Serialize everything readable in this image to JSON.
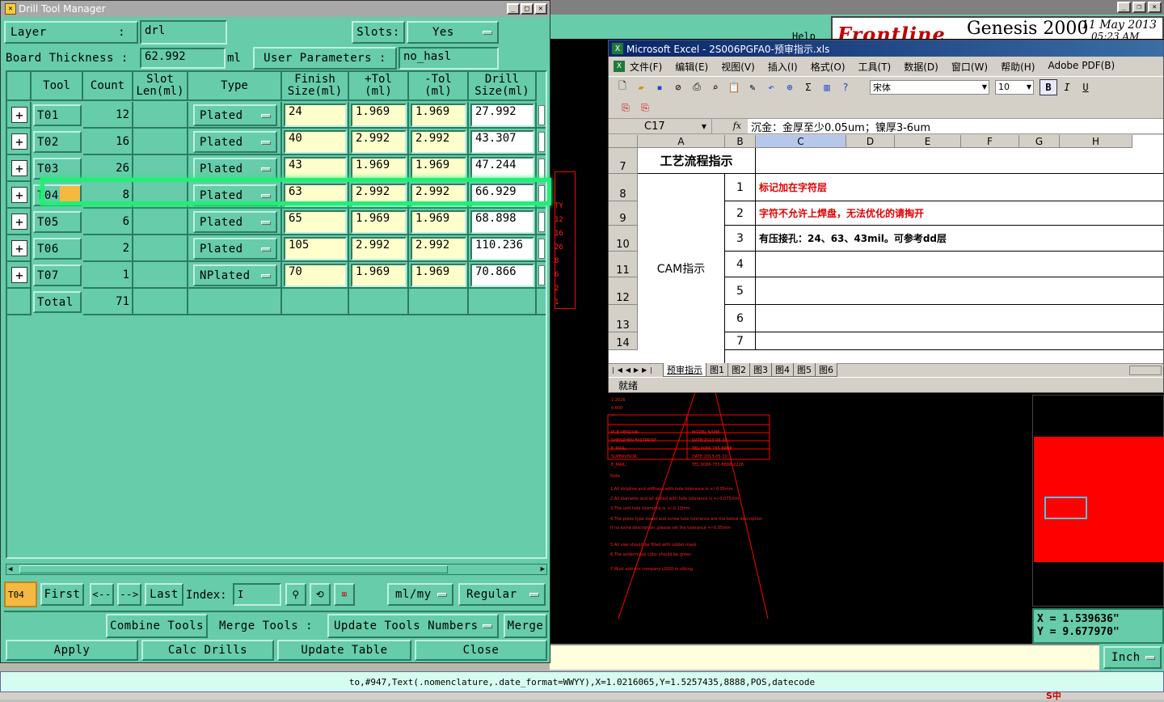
{
  "drill": {
    "title": "Drill Tool Manager",
    "layer_label": "Layer",
    "layer_colon": ":",
    "layer_value": "drl",
    "slots_label": "Slots:",
    "slots_value": "Yes",
    "thickness_label": "Board Thickness :",
    "thickness_value": "62.992",
    "thickness_unit": "ml",
    "user_params_label": "User Parameters :",
    "user_params_value": "no_hasl",
    "headers": {
      "tool": "Tool",
      "count": "Count",
      "slot1": "Slot",
      "slot2": "Len(ml)",
      "type": "Type",
      "finish1": "Finish",
      "finish2": "Size(ml)",
      "ptol1": "+Tol",
      "ptol2": "(ml)",
      "mtol1": "-Tol",
      "mtol2": "(ml)",
      "drill1": "Drill",
      "drill2": "Size(ml)"
    },
    "rows": [
      {
        "tool": "T01",
        "count": "12",
        "type": "Plated",
        "finish": "24",
        "ptol": "1.969",
        "mtol": "1.969",
        "drill": "27.992"
      },
      {
        "tool": "T02",
        "count": "16",
        "type": "Plated",
        "finish": "40",
        "ptol": "2.992",
        "mtol": "2.992",
        "drill": "43.307"
      },
      {
        "tool": "T03",
        "count": "26",
        "type": "Plated",
        "finish": "43",
        "ptol": "1.969",
        "mtol": "1.969",
        "drill": "47.244"
      },
      {
        "tool": "T04",
        "count": "8",
        "type": "Plated",
        "finish": "63",
        "ptol": "2.992",
        "mtol": "2.992",
        "drill": "66.929"
      },
      {
        "tool": "T05",
        "count": "6",
        "type": "Plated",
        "finish": "65",
        "ptol": "1.969",
        "mtol": "1.969",
        "drill": "68.898"
      },
      {
        "tool": "T06",
        "count": "2",
        "type": "Plated",
        "finish": "105",
        "ptol": "2.992",
        "mtol": "2.992",
        "drill": "110.236"
      },
      {
        "tool": "T07",
        "count": "1",
        "type": "NPlated",
        "finish": "70",
        "ptol": "1.969",
        "mtol": "1.969",
        "drill": "70.866"
      }
    ],
    "total_label": "Total",
    "total_count": "71",
    "current_tool": "T04",
    "nav": {
      "first": "First",
      "prev": "<--",
      "next": "-->",
      "last": "Last",
      "index_label": "Index:",
      "units": "ml/my",
      "mode": "Regular"
    },
    "actions": {
      "combine": "Combine Tools",
      "merge_label": "Merge Tools :",
      "update_numbers": "Update Tools Numbers",
      "merge": "Merge",
      "apply": "Apply",
      "calc": "Calc Drills",
      "update_table": "Update Table",
      "close": "Close"
    }
  },
  "genesis": {
    "help": "Help",
    "logo": "Frontline",
    "title": "Genesis 2000",
    "date": "11 May 2013",
    "time": "05:23 AM",
    "x_label": "X =",
    "x_value": "1.539636\"",
    "y_label": "Y =",
    "y_value": "9.677970\"",
    "unit": "Inch",
    "command": "to,#947,Text(.nomenclature,.date_format=WWYY),X=1.0216065,Y=1.5257435,8888,POS,datecode",
    "side_labels": [
      "TY",
      "12",
      "16",
      "26",
      "8",
      "6",
      "2",
      "1"
    ],
    "red_lines": [
      "1.2026",
      "0.600",
      "...",
      "PCB VENDOR:",
      "SHENZHEN FASTPRINT",
      "E_MAIL:",
      "SUPERVISOR:",
      "E_MAIL:",
      "MODEL NAME",
      "DATE:2013-05-10",
      "TEL:0086-755-8888",
      "DATE:2013-05-10",
      "TEL:0086-755-8888-2228"
    ],
    "notes": [
      "Note",
      "1.All stripline and stiffness with hole tolerance is +/-0.05mm",
      "2.All diameter and all drilled with hole tolerance is +/-0.075mm",
      "3.The unit hole tolerance is +/-0.10mm",
      "4.The press type dowel and screw hole tolerance are the below description",
      "  If no extra description ,please set the tolerance +/-0.05mm",
      "5.All vias should be filled with solder mask",
      "6.The soldermask color should be green",
      "7.Must add our company LOGO in silking"
    ]
  },
  "excel": {
    "title": "Microsoft Excel - 2S006PGFA0-预审指示.xls",
    "menu": [
      "文件(F)",
      "编辑(E)",
      "视图(V)",
      "插入(I)",
      "格式(O)",
      "工具(T)",
      "数据(D)",
      "窗口(W)",
      "帮助(H)",
      "Adobe PDF(B)"
    ],
    "font": "宋体",
    "size": "10",
    "bold": "B",
    "italic": "I",
    "underline": "U",
    "cellref": "C17",
    "fx": "fx",
    "formula": "沉金：金厚至少0.05um；镍厚3-6um",
    "cols": [
      "A",
      "B",
      "C",
      "D",
      "E",
      "F",
      "G",
      "H"
    ],
    "rows": [
      "7",
      "8",
      "9",
      "10",
      "11",
      "12",
      "13",
      "14"
    ],
    "header_cell": "工艺流程指示",
    "cam_label": "CAM指示",
    "items": [
      {
        "no": "1",
        "text": "标记加在字符层",
        "red": true
      },
      {
        "no": "2",
        "text": "字符不允许上焊盘，无法优化的请掏开",
        "red": true
      },
      {
        "no": "3",
        "text": "有压接孔：24、63、43mil。可参考dd层",
        "red": false
      },
      {
        "no": "4",
        "text": "",
        "red": false
      },
      {
        "no": "5",
        "text": "",
        "red": false
      },
      {
        "no": "6",
        "text": "",
        "red": false
      },
      {
        "no": "7",
        "text": "",
        "red": false
      }
    ],
    "sheets": [
      "预审指示",
      "图1",
      "图2",
      "图3",
      "图4",
      "图5",
      "图6"
    ],
    "status": "就绪"
  },
  "taskbar": {
    "ime": "S中"
  },
  "colors": {
    "teal": "#66ccaa",
    "field": "#ffffcc",
    "highlight": "#f5b942",
    "select": "#22ee77",
    "red": "#ff0000",
    "excel_title": "#0a246a"
  }
}
